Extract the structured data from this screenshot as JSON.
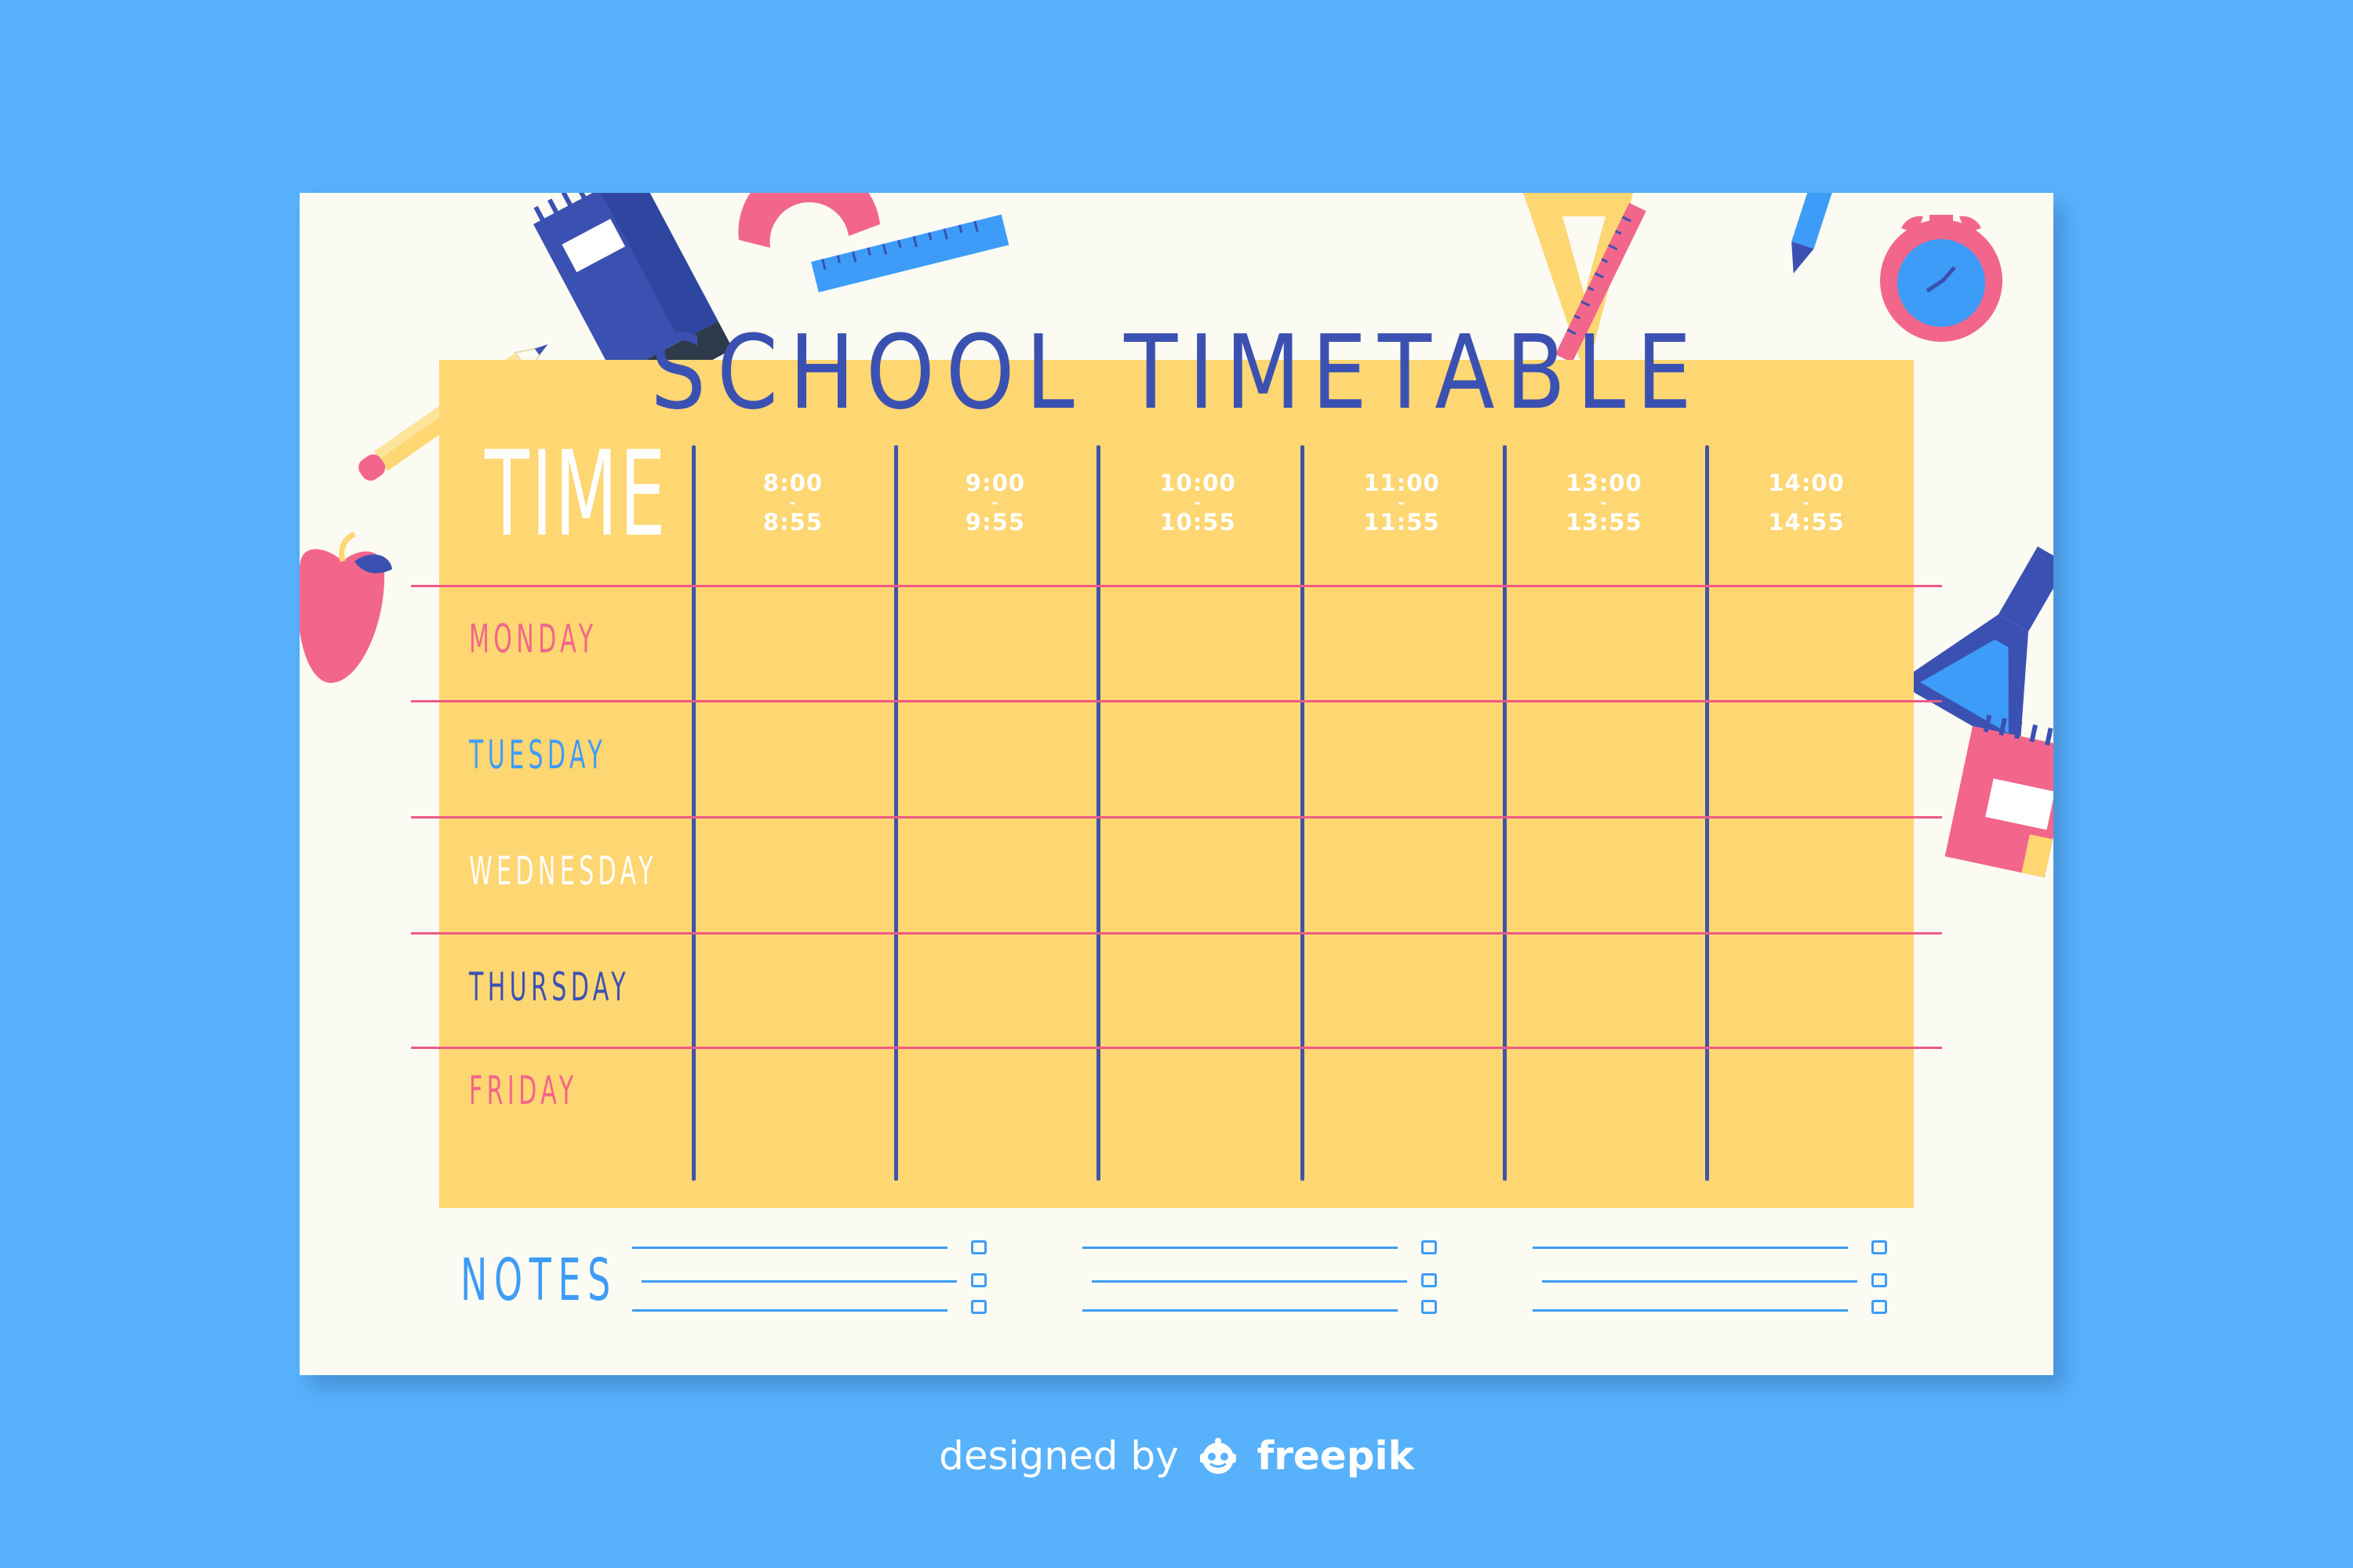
{
  "title": "SCHOOL TIMETABLE",
  "time_header": "TIME",
  "time_slots": [
    {
      "start": "8:00",
      "sep": "-",
      "end": "8:55"
    },
    {
      "start": "9:00",
      "sep": "-",
      "end": "9:55"
    },
    {
      "start": "10:00",
      "sep": "-",
      "end": "10:55"
    },
    {
      "start": "11:00",
      "sep": "-",
      "end": "11:55"
    },
    {
      "start": "13:00",
      "sep": "-",
      "end": "13:55"
    },
    {
      "start": "14:00",
      "sep": "-",
      "end": "14:55"
    }
  ],
  "days": [
    {
      "label": "MONDAY",
      "color": "#f2668b"
    },
    {
      "label": "TUESDAY",
      "color": "#3d9cf7"
    },
    {
      "label": "WEDNESDAY",
      "color": "#ffffff"
    },
    {
      "label": "THURSDAY",
      "color": "#3b51b2"
    },
    {
      "label": "FRIDAY",
      "color": "#f2668b"
    }
  ],
  "notes_label": "NOTES",
  "credit": {
    "prefix": "designed by",
    "brand": "freepik"
  },
  "colors": {
    "background": "#58b1fb",
    "card": "#fbfbf3",
    "panel": "#fed672",
    "title": "#3b51b2",
    "grid_vertical": "#4153ab",
    "grid_horizontal": "#ee5a86",
    "notes": "#3d9cf7"
  },
  "icons": [
    "pencil-icon",
    "notebook-icon",
    "protractor-ruler-icon",
    "set-square-icon",
    "pen-icon",
    "alarm-clock-icon",
    "apple-icon",
    "flask-icon",
    "calendar-icon",
    "freepik-logo-icon"
  ]
}
